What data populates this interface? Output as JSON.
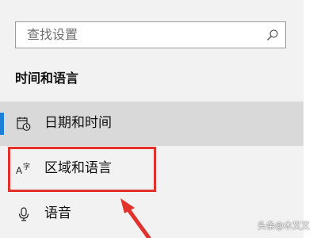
{
  "search": {
    "placeholder": "查找设置",
    "icon": "search-icon"
  },
  "section": {
    "title": "时间和语言"
  },
  "nav_items": [
    {
      "label": "日期和时间",
      "icon": "calendar-clock-icon",
      "selected": true
    },
    {
      "label": "区域和语言",
      "icon": "language-icon",
      "selected": false
    },
    {
      "label": "语音",
      "icon": "microphone-icon",
      "selected": false
    }
  ],
  "annotation": {
    "highlight_color": "#e3312c"
  },
  "watermark": {
    "text": "头条@木又又"
  },
  "colors": {
    "accent": "#1e7fd6",
    "selected_background": "#d9d9d9",
    "background": "#f2f2f2"
  }
}
